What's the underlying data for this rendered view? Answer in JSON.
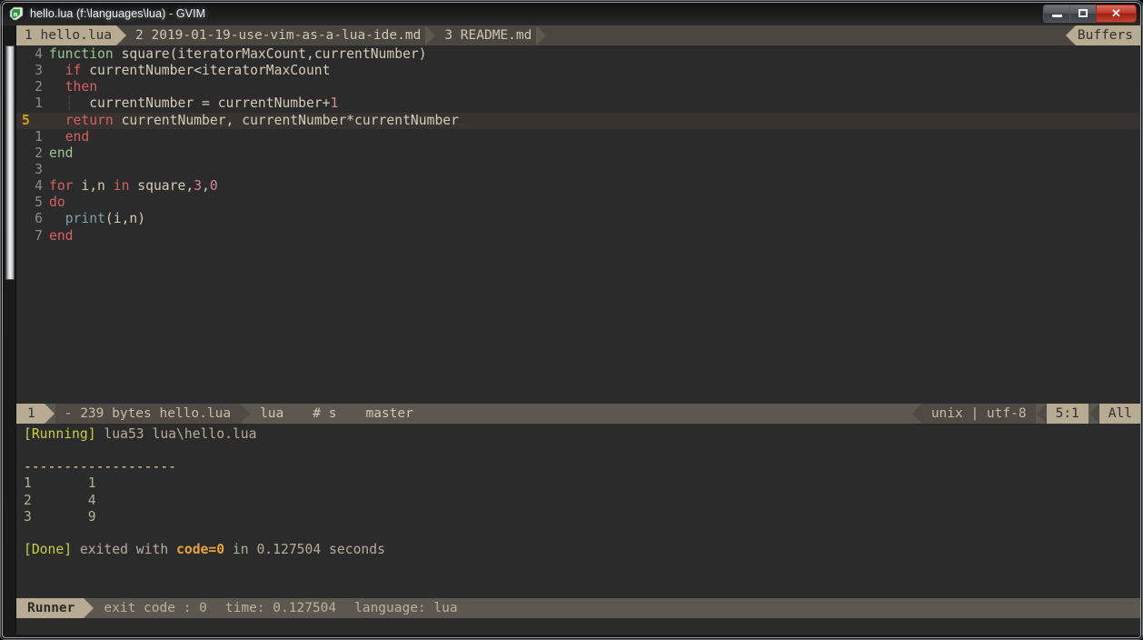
{
  "window": {
    "title": "hello.lua (f:\\languages\\lua) - GVIM",
    "icon": "gvim-icon",
    "buttons": {
      "minimize": "minimize",
      "maximize": "maximize",
      "close": "✕"
    }
  },
  "tabline": {
    "tabs": [
      {
        "label": "1 hello.lua",
        "active": true
      },
      {
        "label": "2 2019-01-19-use-vim-as-a-lua-ide.md",
        "active": false
      },
      {
        "label": "3 README.md",
        "active": false
      }
    ],
    "right_label": "Buffers"
  },
  "editor": {
    "lines": [
      {
        "num": "4",
        "current": false,
        "tokens": [
          {
            "t": "function",
            "c": "kw2"
          },
          {
            "t": " ",
            "c": "id"
          },
          {
            "t": "square(iteratorMaxCount,currentNumber)",
            "c": "id"
          }
        ]
      },
      {
        "num": "3",
        "current": false,
        "tokens": [
          {
            "t": "  ",
            "c": "id"
          },
          {
            "t": "if",
            "c": "kw"
          },
          {
            "t": " currentNumber<iteratorMaxCount",
            "c": "id"
          }
        ]
      },
      {
        "num": "2",
        "current": false,
        "tokens": [
          {
            "t": "  ",
            "c": "id"
          },
          {
            "t": "then",
            "c": "kw"
          }
        ]
      },
      {
        "num": "1",
        "current": false,
        "tokens": [
          {
            "t": "  ",
            "c": "id"
          },
          {
            "t": "┆",
            "c": "iguide"
          },
          {
            "t": "  currentNumber = currentNumber+",
            "c": "id"
          },
          {
            "t": "1",
            "c": "num"
          }
        ]
      },
      {
        "num": "5",
        "current": true,
        "tokens": [
          {
            "t": "  ",
            "c": "id"
          },
          {
            "t": "return",
            "c": "kw"
          },
          {
            "t": " currentNumber, currentNumber*currentNumber",
            "c": "id"
          }
        ]
      },
      {
        "num": "1",
        "current": false,
        "tokens": [
          {
            "t": "  ",
            "c": "id"
          },
          {
            "t": "end",
            "c": "kw"
          }
        ]
      },
      {
        "num": "2",
        "current": false,
        "tokens": [
          {
            "t": "end",
            "c": "kw2"
          }
        ]
      },
      {
        "num": "3",
        "current": false,
        "tokens": [
          {
            "t": "",
            "c": "id"
          }
        ]
      },
      {
        "num": "4",
        "current": false,
        "tokens": [
          {
            "t": "for",
            "c": "kw"
          },
          {
            "t": " i,n ",
            "c": "id"
          },
          {
            "t": "in",
            "c": "kw"
          },
          {
            "t": " square,",
            "c": "id"
          },
          {
            "t": "3",
            "c": "num"
          },
          {
            "t": ",",
            "c": "id"
          },
          {
            "t": "0",
            "c": "num"
          }
        ]
      },
      {
        "num": "5",
        "current": false,
        "tokens": [
          {
            "t": "do",
            "c": "kw"
          }
        ]
      },
      {
        "num": "6",
        "current": false,
        "tokens": [
          {
            "t": "  ",
            "c": "id"
          },
          {
            "t": "print",
            "c": "call"
          },
          {
            "t": "(i,n)",
            "c": "id"
          }
        ]
      },
      {
        "num": "7",
        "current": false,
        "tokens": [
          {
            "t": "end",
            "c": "kw"
          }
        ]
      }
    ]
  },
  "statusline": {
    "mode": "1",
    "file": "- 239 bytes hello.lua",
    "filetype": "lua",
    "diff": "# s",
    "branch": "master",
    "encoding": "unix | utf-8",
    "position": "5:1",
    "percent": "All"
  },
  "terminal": {
    "rows": [
      {
        "segments": [
          {
            "t": "[Running]",
            "c": "t-running"
          },
          {
            "t": " lua53 lua\\hello.lua",
            "c": "t-dim"
          }
        ]
      },
      {
        "segments": [
          {
            "t": "",
            "c": "t-dim"
          }
        ]
      },
      {
        "segments": [
          {
            "t": "-------------------",
            "c": "t-dash"
          }
        ]
      },
      {
        "segments": [
          {
            "t": "1\t1",
            "c": "t-dim"
          }
        ]
      },
      {
        "segments": [
          {
            "t": "2\t4",
            "c": "t-dim"
          }
        ]
      },
      {
        "segments": [
          {
            "t": "3\t9",
            "c": "t-dim"
          }
        ]
      },
      {
        "segments": [
          {
            "t": "",
            "c": "t-dim"
          }
        ]
      },
      {
        "segments": [
          {
            "t": "[Done]",
            "c": "t-done"
          },
          {
            "t": " exited with ",
            "c": "t-dim"
          },
          {
            "t": "code=0",
            "c": "t-code"
          },
          {
            "t": " in 0.127504 seconds",
            "c": "t-dim"
          }
        ]
      }
    ]
  },
  "runnerline": {
    "title": "Runner",
    "exit_code": "exit code : 0",
    "time": "time: 0.127504",
    "language": "language: lua"
  }
}
